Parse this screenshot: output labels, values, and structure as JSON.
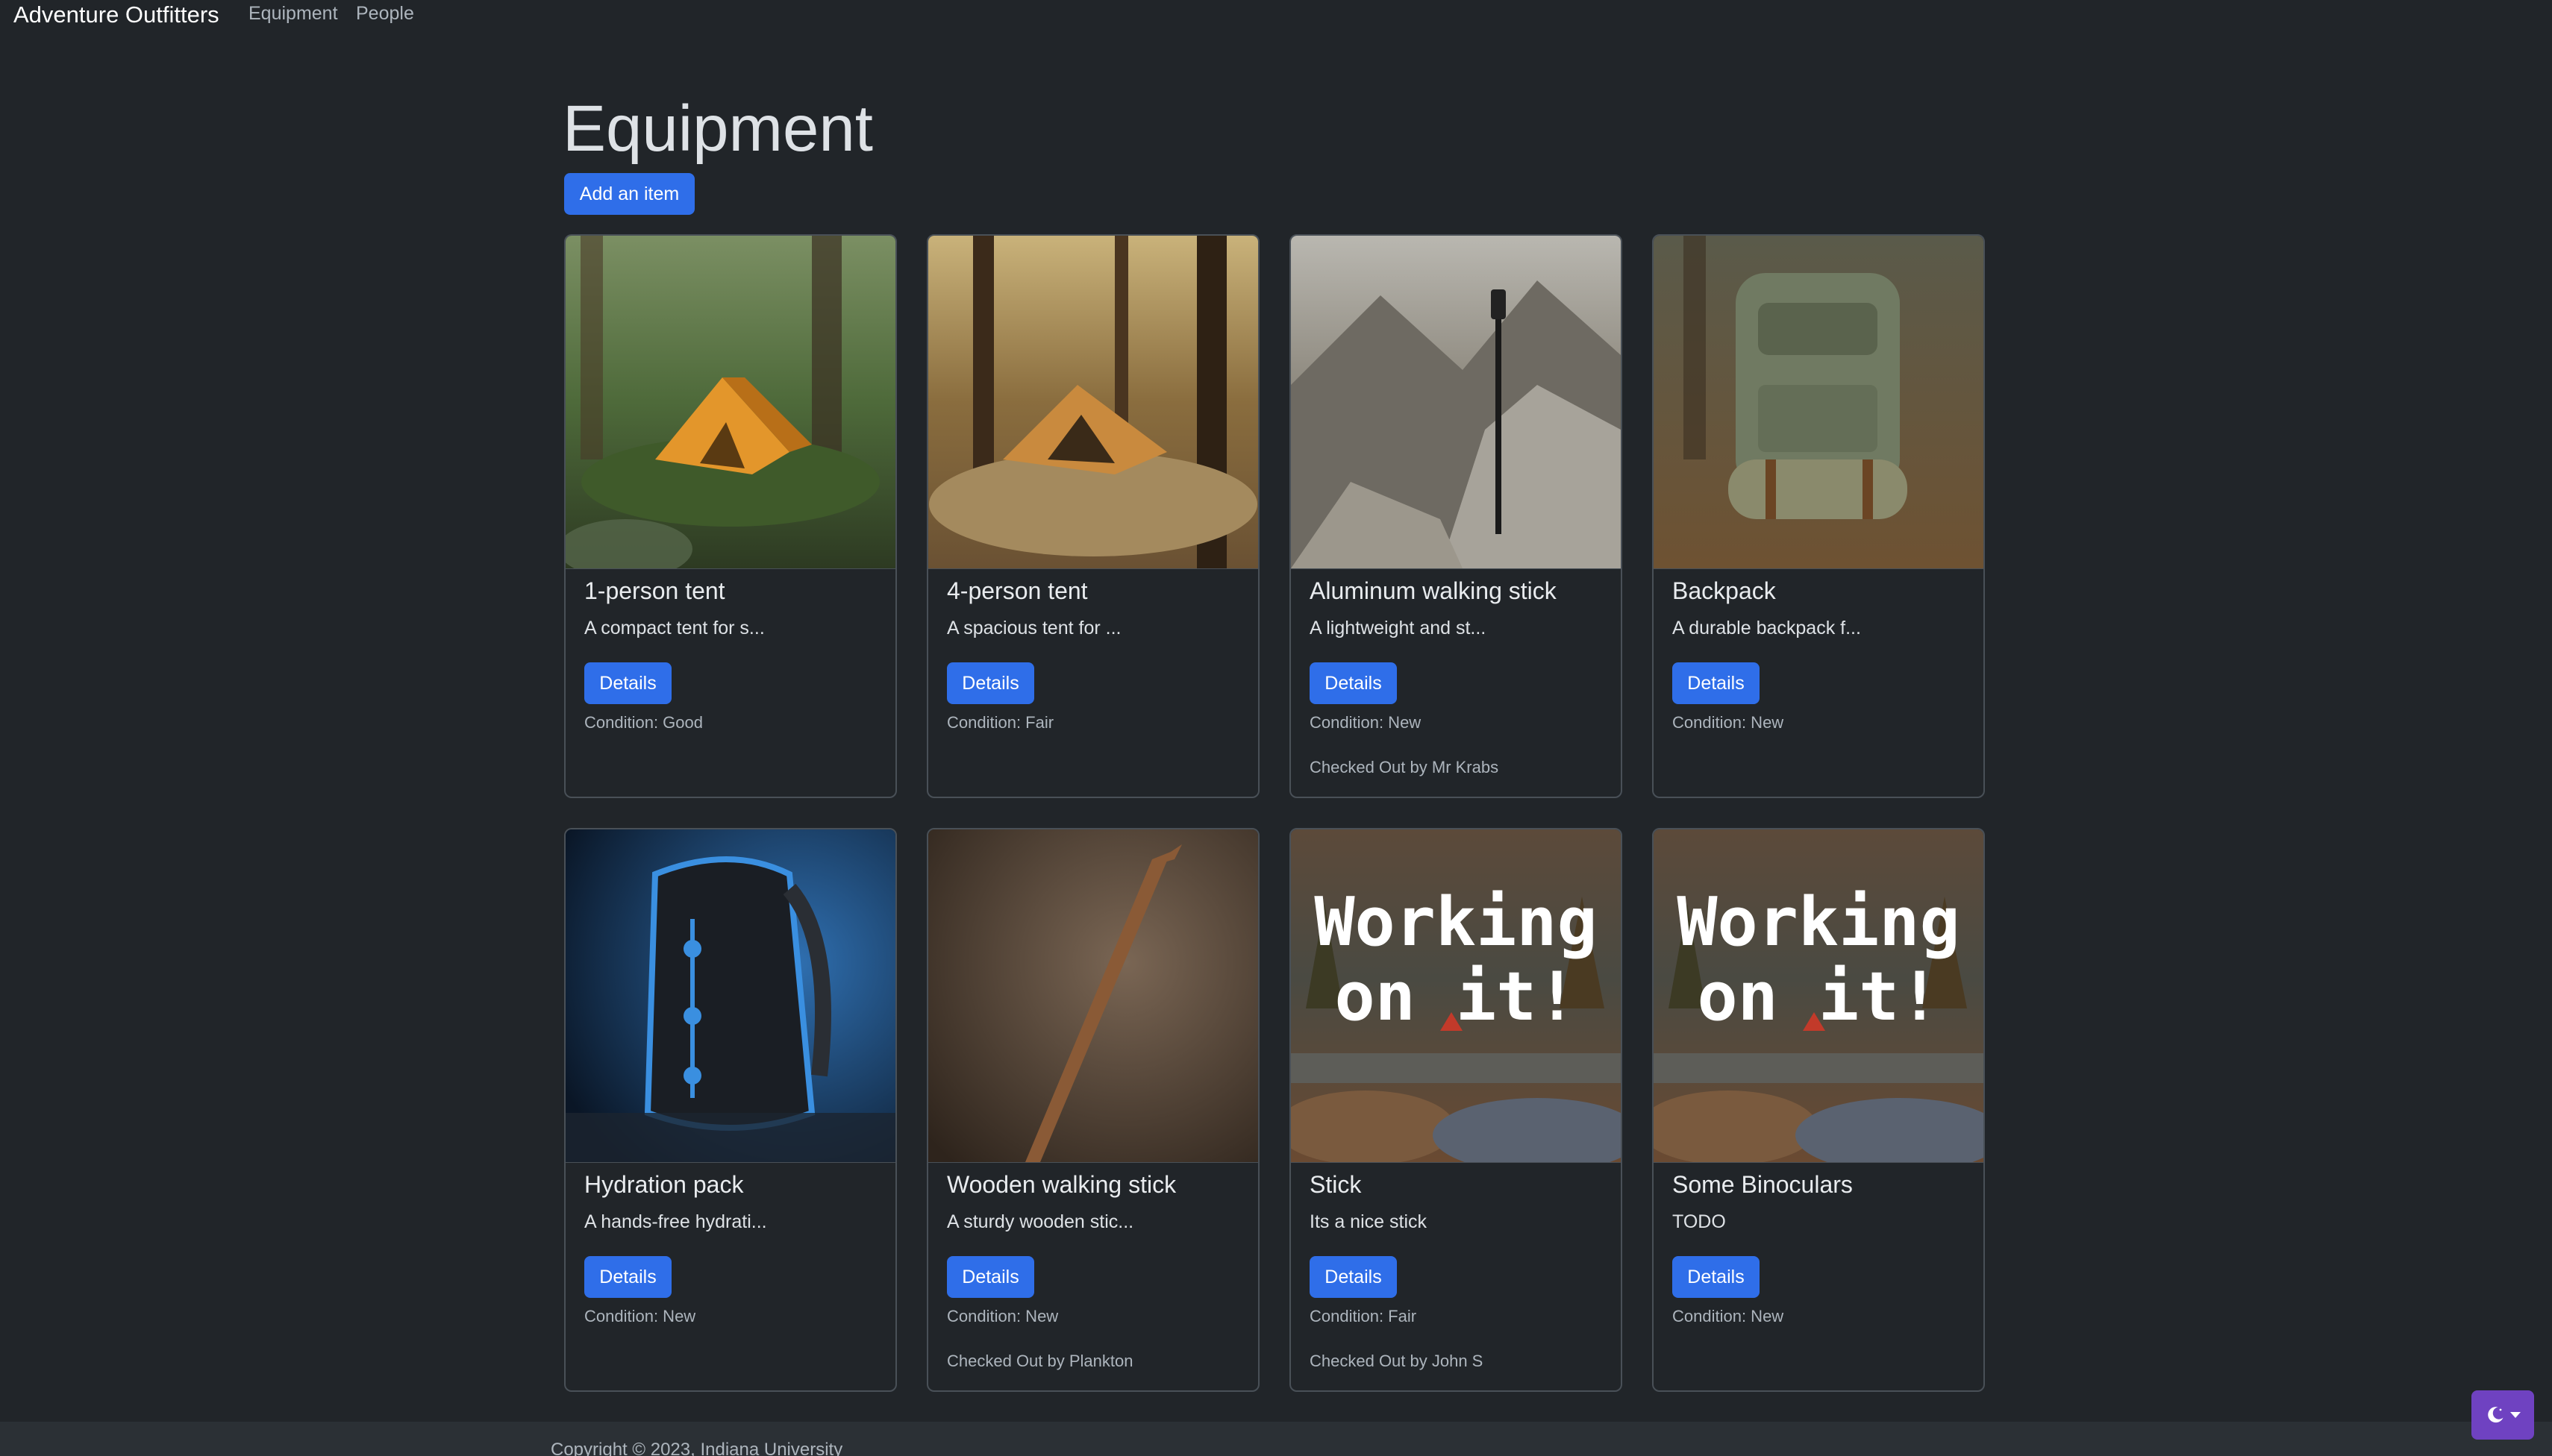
{
  "nav": {
    "brand": "Adventure Outfitters",
    "links": [
      {
        "label": "Equipment"
      },
      {
        "label": "People"
      }
    ]
  },
  "page": {
    "title": "Equipment",
    "add_button_label": "Add an item"
  },
  "items": [
    {
      "name": "1-person tent",
      "description": "A compact tent for s...",
      "details_label": "Details",
      "condition": "Condition: Good",
      "checked_out": "",
      "image": "tent-forest-image"
    },
    {
      "name": "4-person tent",
      "description": "A spacious tent for ...",
      "details_label": "Details",
      "condition": "Condition: Fair",
      "checked_out": "",
      "image": "tent-campsite-image"
    },
    {
      "name": "Aluminum walking stick",
      "description": "A lightweight and st...",
      "details_label": "Details",
      "condition": "Condition: New",
      "checked_out": "Checked Out by Mr Krabs",
      "image": "walking-stick-mountain-image"
    },
    {
      "name": "Backpack",
      "description": "A durable backpack f...",
      "details_label": "Details",
      "condition": "Condition: New",
      "checked_out": "",
      "image": "backpack-image"
    },
    {
      "name": "Hydration pack",
      "description": "A hands-free hydrati...",
      "details_label": "Details",
      "condition": "Condition: New",
      "checked_out": "",
      "image": "hydration-pack-image"
    },
    {
      "name": "Wooden walking stick",
      "description": "A sturdy wooden stic...",
      "details_label": "Details",
      "condition": "Condition: New",
      "checked_out": "Checked Out by Plankton",
      "image": "wooden-stick-image"
    },
    {
      "name": "Stick",
      "description": "Its a nice stick",
      "details_label": "Details",
      "condition": "Condition: Fair",
      "checked_out": "Checked Out by John S",
      "image": "working-on-it-image",
      "image_text": [
        "Working",
        "on it!"
      ]
    },
    {
      "name": "Some Binoculars",
      "description": "TODO",
      "details_label": "Details",
      "condition": "Condition: New",
      "checked_out": "",
      "image": "working-on-it-image",
      "image_text": [
        "Working",
        "on it!"
      ]
    }
  ],
  "footer": {
    "copyright": "Copyright © 2023, Indiana University"
  },
  "theme_toggle": {
    "icon": "moon-icon"
  },
  "colors": {
    "background": "#212529",
    "primary": "#2f6ee9",
    "theme_button": "#6f42c1"
  }
}
